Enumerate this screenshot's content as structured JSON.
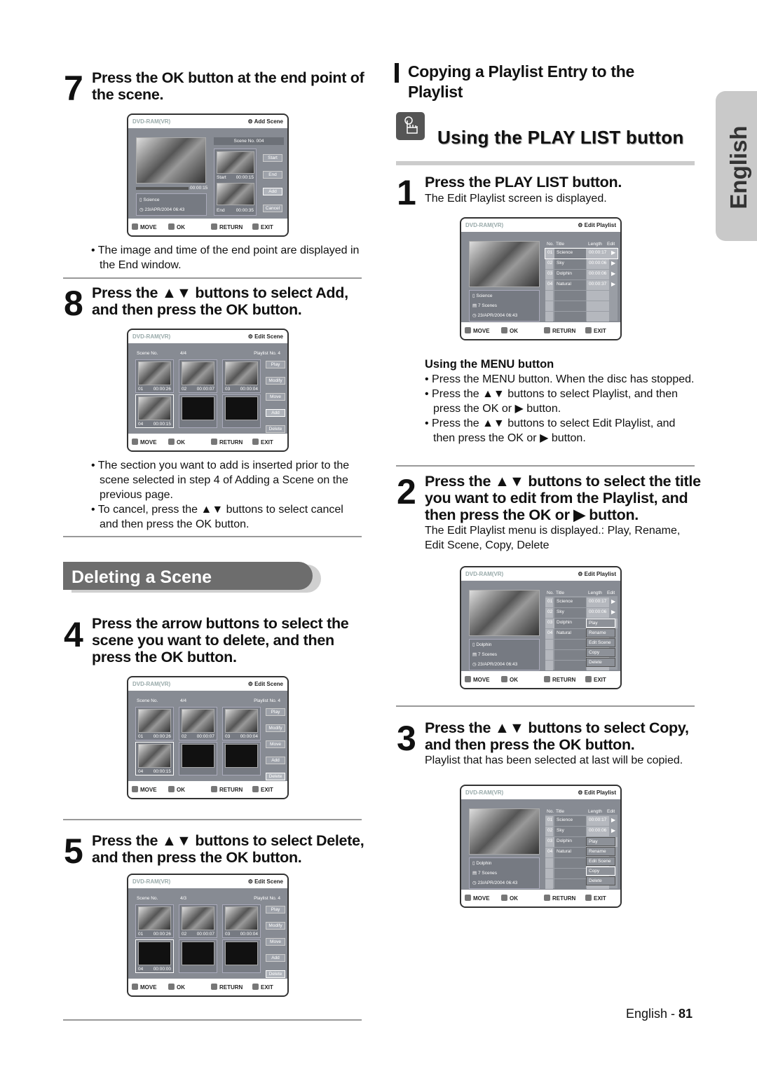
{
  "tab_label": "English",
  "footer": {
    "lang": "English - ",
    "page": "81"
  },
  "left": {
    "step7": {
      "num": "7",
      "heading": [
        "Press the OK button at the end point of",
        "the scene."
      ],
      "bullets": [
        "The image and time of the end point are displayed in the End window."
      ]
    },
    "step8": {
      "num": "8",
      "heading": [
        "Press the ▲▼ buttons to select Add,",
        "and then press the OK button."
      ],
      "bullets": [
        "The section you want to add is inserted prior to the scene selected in step 4 of Adding a Scene on the previous page.",
        "To cancel, press the ▲▼ buttons to select cancel and then press the OK button."
      ]
    },
    "section_title": "Deleting a Scene",
    "step4": {
      "num": "4",
      "heading": [
        "Press the arrow buttons to select the",
        "scene you want to delete, and then",
        "press the OK button."
      ]
    },
    "step5": {
      "num": "5",
      "heading": [
        "Press the ▲▼ buttons to select Delete,",
        "and then press the OK button."
      ]
    }
  },
  "right": {
    "section_title": [
      "Copying a Playlist Entry to the",
      "Playlist"
    ],
    "subsection_title": "Using the PLAY LIST button",
    "subsection_icon": "hand-pointer-icon",
    "step1": {
      "num": "1",
      "heading": "Press the PLAY LIST button.",
      "sub": "The Edit Playlist screen is displayed."
    },
    "menu_title": "Using the MENU button",
    "menu_bullets": [
      "Press the MENU button. When the disc has stopped.",
      "Press the ▲▼ buttons to select Playlist, and then press the OK or ▶ button.",
      "Press the ▲▼ buttons to select Edit Playlist, and then press the OK or ▶ button."
    ],
    "step2": {
      "num": "2",
      "heading": [
        "Press the ▲▼ buttons to select the title",
        "you want to edit from the Playlist, and",
        "then press the OK or ▶ button."
      ],
      "sub": [
        "The Edit Playlist menu is displayed.: Play, Rename,",
        "Edit Scene, Copy, Delete"
      ]
    },
    "step3": {
      "num": "3",
      "heading": [
        "Press the ▲▼ buttons to select Copy,",
        "and then press the OK button."
      ],
      "sub": "Playlist that has been selected at last will be copied."
    }
  },
  "screens": {
    "common": {
      "disc": "DVD-RAM(VR)",
      "footer": [
        "MOVE",
        "OK",
        "RETURN",
        "EXIT"
      ]
    },
    "s7": {
      "type": "add",
      "title": "Add Scene",
      "scene_no": "Scene No. 004",
      "time": "00:00:15",
      "name": "Science",
      "date": "23/APR/2004 06:43",
      "start": [
        "Start",
        "00:00:15"
      ],
      "end": [
        "End",
        "00:00:35"
      ],
      "buttons": [
        "Start",
        "End",
        "Add",
        "Cancel"
      ],
      "selected": 2
    },
    "s8": {
      "type": "scene",
      "title": "Edit Scene",
      "scene_label": "Scene No.",
      "count": "4/4",
      "playlist": "Playlist No.  4",
      "thumbs": [
        [
          "01",
          "00:00:26",
          1
        ],
        [
          "02",
          "00:00:07",
          1
        ],
        [
          "03",
          "00:00:04",
          1
        ],
        [
          "04",
          "00:00:15",
          1
        ],
        [
          "",
          "",
          0
        ],
        [
          "",
          "",
          0
        ]
      ],
      "buttons": [
        "Play",
        "Modify",
        "Move",
        "Add",
        "Delete"
      ],
      "selected": 3
    },
    "s4": {
      "type": "scene",
      "title": "Edit Scene",
      "scene_label": "Scene No.",
      "count": "4/4",
      "playlist": "Playlist No.  4",
      "thumbs": [
        [
          "01",
          "00:00:26",
          1
        ],
        [
          "02",
          "00:00:07",
          1
        ],
        [
          "03",
          "00:00:04",
          1
        ],
        [
          "04",
          "00:00:15",
          1
        ],
        [
          "",
          "",
          0
        ],
        [
          "",
          "",
          0
        ]
      ],
      "buttons": [
        "Play",
        "Modify",
        "Move",
        "Add",
        "Delete"
      ],
      "selected": 4
    },
    "s5": {
      "type": "scene",
      "title": "Edit Scene",
      "scene_label": "Scene No.",
      "count": "4/3",
      "playlist": "Playlist No.  4",
      "thumbs": [
        [
          "01",
          "00:00:26",
          1
        ],
        [
          "02",
          "00:00:07",
          1
        ],
        [
          "03",
          "00:00:04",
          1
        ],
        [
          "04",
          "00:00:00",
          0
        ],
        [
          "",
          "",
          0
        ],
        [
          "",
          "",
          0
        ]
      ],
      "buttons": [
        "Play",
        "Modify",
        "Move",
        "Add",
        "Delete"
      ],
      "selected": 4
    },
    "r1": {
      "type": "playlist",
      "title": "Edit Playlist",
      "cols": [
        "No.",
        "Title",
        "Length",
        "Edit"
      ],
      "name": "Science",
      "scenes": "7 Scenes",
      "date": "23/APR/2004 06:43",
      "rows": [
        [
          "01",
          "Science",
          "00:00:17"
        ],
        [
          "02",
          "Sky",
          "00:00:06"
        ],
        [
          "03",
          "Dolphin",
          "00:00:06"
        ],
        [
          "04",
          "Natural",
          "00:00:37"
        ]
      ],
      "sel_row": 0,
      "menu": [],
      "menu_sel": -1
    },
    "r2": {
      "type": "playlist",
      "title": "Edit Playlist",
      "cols": [
        "No.",
        "Title",
        "Length",
        "Edit"
      ],
      "name": "Dolphin",
      "scenes": "7 Scenes",
      "date": "23/APR/2004 06:43",
      "rows": [
        [
          "01",
          "Science",
          "00:00:17"
        ],
        [
          "02",
          "Sky",
          "00:00:06"
        ],
        [
          "03",
          "Dolphin",
          ""
        ],
        [
          "04",
          "Natural",
          ""
        ]
      ],
      "sel_row": 2,
      "menu": [
        "Play",
        "Rename",
        "Edit Scene",
        "Copy",
        "Delete"
      ],
      "menu_sel": 0
    },
    "r3": {
      "type": "playlist",
      "title": "Edit Playlist",
      "cols": [
        "No.",
        "Title",
        "Length",
        "Edit"
      ],
      "name": "Dolphin",
      "scenes": "7 Scenes",
      "date": "23/APR/2004 06:43",
      "rows": [
        [
          "01",
          "Science",
          "00:00:17"
        ],
        [
          "02",
          "Sky",
          "00:00:06"
        ],
        [
          "03",
          "Dolphin",
          ""
        ],
        [
          "04",
          "Natural",
          ""
        ]
      ],
      "sel_row": 2,
      "menu": [
        "Play",
        "Rename",
        "Edit Scene",
        "Copy",
        "Delete"
      ],
      "menu_sel": 3
    }
  }
}
